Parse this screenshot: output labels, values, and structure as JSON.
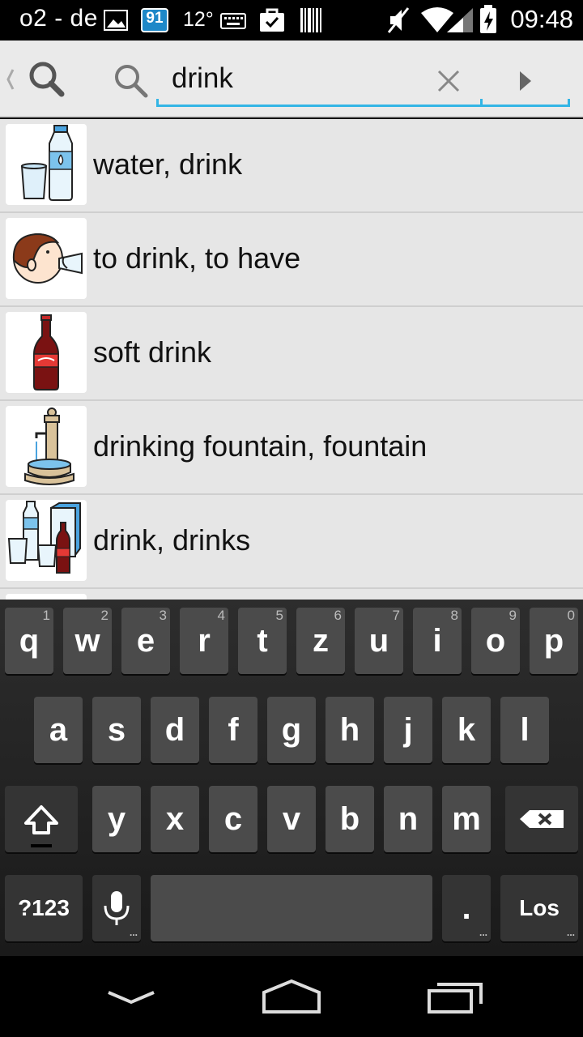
{
  "status_bar": {
    "carrier": "o2 - de",
    "notification_badge": "91",
    "temperature": "12°",
    "time": "09:48",
    "icons": [
      "image-icon",
      "calendar-badge-icon",
      "keyboard-icon",
      "shopping-bag-icon",
      "barcode-icon",
      "muted-icon",
      "wifi-icon",
      "signal-icon",
      "battery-charging-icon"
    ]
  },
  "search": {
    "query": "drink",
    "icons": [
      "back-search-icon",
      "search-icon",
      "clear-icon",
      "go-arrow-icon"
    ]
  },
  "results": [
    {
      "label": "water, drink",
      "icon": "water-bottle-glass-icon"
    },
    {
      "label": "to drink, to have",
      "icon": "person-drinking-icon"
    },
    {
      "label": "soft drink",
      "icon": "soda-bottle-icon"
    },
    {
      "label": "drinking fountain, fountain",
      "icon": "drinking-fountain-icon"
    },
    {
      "label": "drink, drinks",
      "icon": "assorted-drinks-icon"
    }
  ],
  "keyboard": {
    "row1": [
      {
        "key": "q",
        "hint": "1"
      },
      {
        "key": "w",
        "hint": "2"
      },
      {
        "key": "e",
        "hint": "3"
      },
      {
        "key": "r",
        "hint": "4"
      },
      {
        "key": "t",
        "hint": "5"
      },
      {
        "key": "z",
        "hint": "6"
      },
      {
        "key": "u",
        "hint": "7"
      },
      {
        "key": "i",
        "hint": "8"
      },
      {
        "key": "o",
        "hint": "9"
      },
      {
        "key": "p",
        "hint": "0"
      }
    ],
    "row2": [
      "a",
      "s",
      "d",
      "f",
      "g",
      "h",
      "j",
      "k",
      "l"
    ],
    "row3": [
      "y",
      "x",
      "c",
      "v",
      "b",
      "n",
      "m"
    ],
    "symbols_label": "?123",
    "period_label": ".",
    "enter_label": "Los",
    "icons": [
      "shift-icon",
      "backspace-icon",
      "microphone-icon"
    ]
  },
  "nav_bar": {
    "icons": [
      "hide-keyboard-icon",
      "home-icon",
      "recent-apps-icon"
    ]
  },
  "colors": {
    "accent": "#33b5e5",
    "list_background": "#e6e6e6",
    "key_background": "#4b4b4b"
  }
}
